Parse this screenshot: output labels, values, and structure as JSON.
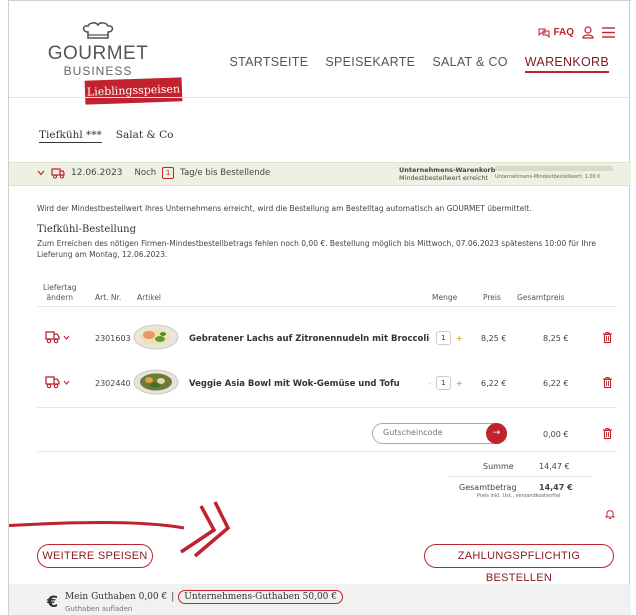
{
  "brand": {
    "name": "GOURMET",
    "sub": "BUSINESS",
    "tag": "Lieblingsspeisen"
  },
  "topbar": {
    "faq": "FAQ"
  },
  "nav": [
    "STARTSEITE",
    "SPEISEKARTE",
    "SALAT & CO",
    "WARENKORB"
  ],
  "tabs": [
    "Tiefkühl ***",
    "Salat & Co"
  ],
  "order_bar": {
    "date": "12.06.2023",
    "noch": "Noch",
    "count": "1",
    "suffix": "Tag/e bis Bestellende",
    "cart_title": "Unternehmens-Warenkorb",
    "cart_status": "Mindestbestellwert erreicht",
    "min_label": "Unternehmens-Mindestbestellwert: 1,00 €",
    "min_progress": 1
  },
  "info_text": "Wird der Mindestbestellwert Ihres Unternehmens erreicht, wird die Bestellung am Bestelltag automatisch an GOURMET übermittelt.",
  "section": {
    "title": "Tiefkühl-Bestellung",
    "desc": "Zum Erreichen des nötigen Firmen-Mindestbestellbetrags fehlen noch 0,00 €. Bestellung möglich bis Mittwoch, 07.06.2023 spätestens 10:00 für Ihre Lieferung am Montag, 12.06.2023."
  },
  "table": {
    "headers": {
      "lieferung1": "Liefertag",
      "lieferung2": "ändern",
      "artnr": "Art. Nr.",
      "artikel": "Artikel",
      "menge": "Menge",
      "preis": "Preis",
      "gesamt": "Gesamtpreis"
    },
    "rows": [
      {
        "artnr": "2301603",
        "name": "Gebratener Lachs auf Zitronennudeln mit Broccoli",
        "qty": "1",
        "price": "8,25 €",
        "total": "8,25 €"
      },
      {
        "artnr": "2302440",
        "name": "Veggie Asia Bowl mit Wok-Gemüse und Tofu",
        "qty": "1",
        "price": "6,22 €",
        "total": "6,22 €"
      }
    ]
  },
  "coupon": {
    "placeholder": "Gutscheincode",
    "value": "0,00 €"
  },
  "summary": {
    "sum_label": "Summe",
    "sum_value": "14,47 €",
    "total_label": "Gesamtbetrag",
    "total_value": "14,47 €",
    "total_note": "Preis inkl. Ust., versandkostenfrei"
  },
  "buttons": {
    "more": "WEITERE SPEISEN",
    "order": "ZAHLUNGSPFLICHTIG BESTELLEN"
  },
  "footer": {
    "credit": "Mein Guthaben 0,00 €",
    "sep": "|",
    "company": "Unternehmens-Guthaben 50,00 €",
    "topup": "Guthaben aufladen"
  },
  "colors": {
    "accent": "#c0222e",
    "bar_bg": "#eef1e2"
  }
}
